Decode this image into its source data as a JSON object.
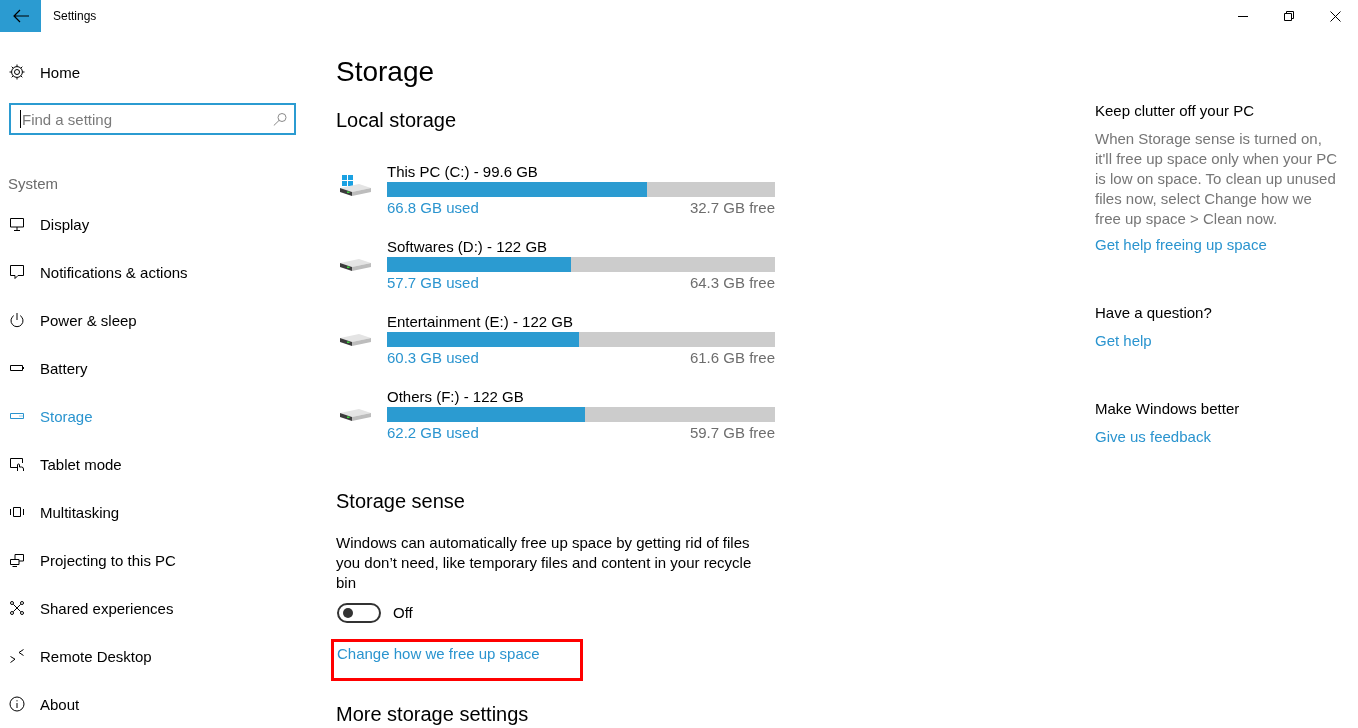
{
  "window": {
    "title": "Settings"
  },
  "sidebar": {
    "home": "Home",
    "search": {
      "placeholder": "Find a setting",
      "focused": true
    },
    "section": "System",
    "items": [
      {
        "label": "Display",
        "selected": false
      },
      {
        "label": "Notifications & actions",
        "selected": false
      },
      {
        "label": "Power & sleep",
        "selected": false
      },
      {
        "label": "Battery",
        "selected": false
      },
      {
        "label": "Storage",
        "selected": true
      },
      {
        "label": "Tablet mode",
        "selected": false
      },
      {
        "label": "Multitasking",
        "selected": false
      },
      {
        "label": "Projecting to this PC",
        "selected": false
      },
      {
        "label": "Shared experiences",
        "selected": false
      },
      {
        "label": "Remote Desktop",
        "selected": false
      },
      {
        "label": "About",
        "selected": false
      }
    ]
  },
  "title": "Storage",
  "local_storage": {
    "heading": "Local storage",
    "drives": [
      {
        "kind": "system",
        "name": "This PC (C:) - 99.6 GB",
        "level": 0.671,
        "used": "66.8 GB used",
        "free": "32.7 GB free"
      },
      {
        "kind": "data",
        "name": "Softwares (D:) - 122 GB",
        "level": 0.473,
        "used": "57.7 GB used",
        "free": "64.3 GB free"
      },
      {
        "kind": "data",
        "name": "Entertainment (E:) - 122 GB",
        "level": 0.494,
        "used": "60.3 GB used",
        "free": "61.6 GB free"
      },
      {
        "kind": "data",
        "name": "Others (F:) - 122 GB",
        "level": 0.51,
        "used": "62.2 GB used",
        "free": "59.7 GB free"
      }
    ]
  },
  "storage_sense": {
    "heading": "Storage sense",
    "description": "Windows can automatically free up space by getting rid of files you don’t need, like temporary files and content in your recycle bin",
    "toggle": {
      "on": false,
      "label": "Off"
    },
    "link": {
      "text": "Change how we free up space",
      "highlighted": true
    }
  },
  "more_storage_settings": {
    "heading": "More storage settings"
  },
  "aside": [
    {
      "heading": "Keep clutter off your PC",
      "text": "When Storage sense is turned on, it'll free up space only when your PC is low on space. To clean up unused files now, select Change how we free up space > Clean now.",
      "link": "Get help freeing up space"
    },
    {
      "heading": "Have a question?",
      "link": "Get help"
    },
    {
      "heading": "Make Windows better",
      "link": "Give us feedback"
    }
  ]
}
